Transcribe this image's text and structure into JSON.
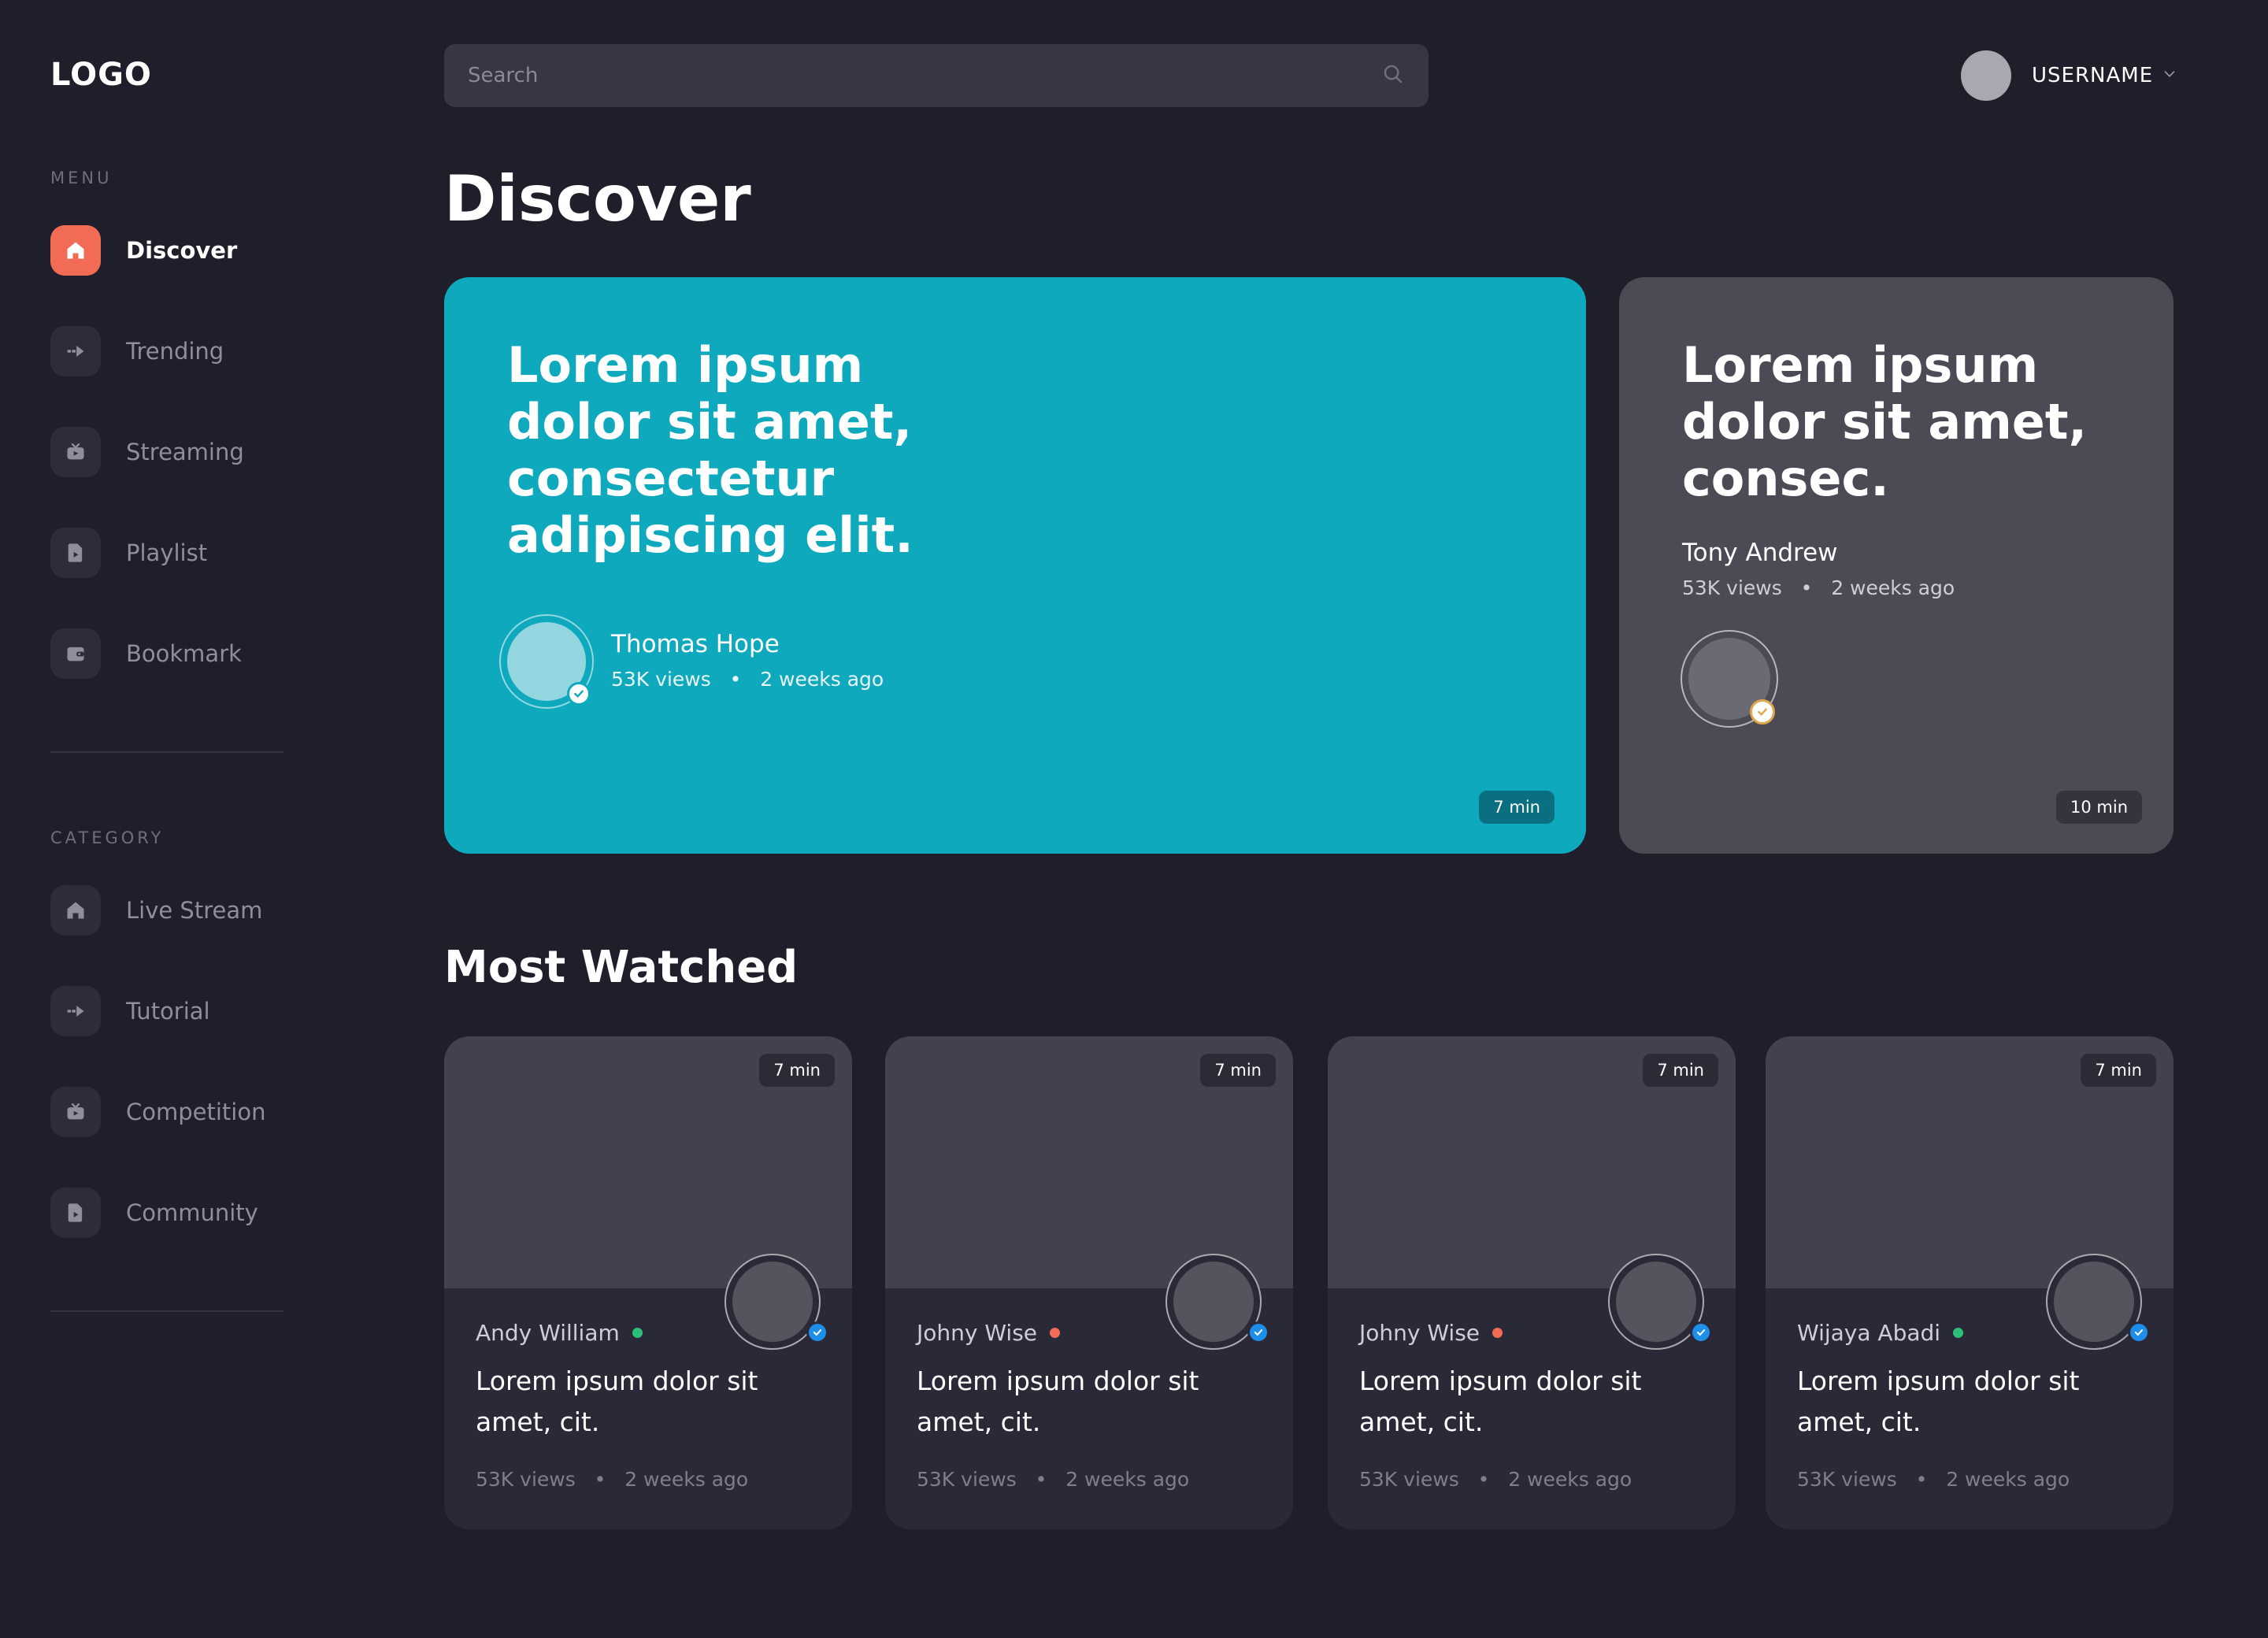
{
  "logo": "LOGO",
  "sidebar": {
    "menu_label": "MENU",
    "menu_items": [
      {
        "label": "Discover",
        "icon": "home-icon",
        "active": true
      },
      {
        "label": "Trending",
        "icon": "arrow-right-icon"
      },
      {
        "label": "Streaming",
        "icon": "tv-icon"
      },
      {
        "label": "Playlist",
        "icon": "document-icon"
      },
      {
        "label": "Bookmark",
        "icon": "wallet-icon"
      }
    ],
    "category_label": "CATEGORY",
    "category_items": [
      {
        "label": "Live Stream",
        "icon": "home-icon"
      },
      {
        "label": "Tutorial",
        "icon": "arrow-right-icon"
      },
      {
        "label": "Competition",
        "icon": "tv-icon"
      },
      {
        "label": "Community",
        "icon": "document-icon"
      }
    ]
  },
  "header": {
    "search_placeholder": "Search",
    "username": "USERNAME"
  },
  "main": {
    "title": "Discover",
    "featured": [
      {
        "title": "Lorem ipsum dolor sit amet, consectetur adipiscing elit.",
        "author": "Thomas Hope",
        "views": "53K views",
        "time": "2 weeks ago",
        "duration": "7 min",
        "color": "#0ea9bd"
      },
      {
        "title": "Lorem ipsum dolor sit amet, consec.",
        "author": "Tony Andrew",
        "views": "53K views",
        "time": "2 weeks ago",
        "duration": "10 min",
        "color": "#4b4a55"
      }
    ],
    "most_watched_title": "Most Watched",
    "most_watched": [
      {
        "author": "Andy William",
        "status_color": "#2bbf7a",
        "title": "Lorem ipsum dolor sit amet, cit.",
        "views": "53K views",
        "time": "2 weeks ago",
        "duration": "7 min"
      },
      {
        "author": "Johny Wise",
        "status_color": "#f26b54",
        "title": "Lorem ipsum dolor sit amet, cit.",
        "views": "53K views",
        "time": "2 weeks ago",
        "duration": "7 min"
      },
      {
        "author": "Johny Wise",
        "status_color": "#f26b54",
        "title": "Lorem ipsum dolor sit amet, cit.",
        "views": "53K views",
        "time": "2 weeks ago",
        "duration": "7 min"
      },
      {
        "author": "Wijaya Abadi",
        "status_color": "#2bbf7a",
        "title": "Lorem ipsum dolor sit amet, cit.",
        "views": "53K views",
        "time": "2 weeks ago",
        "duration": "7 min"
      }
    ]
  },
  "colors": {
    "background": "#1f1e2b",
    "accent": "#f26b54",
    "featured_primary": "#0ea9bd",
    "verified_blue": "#1d8fe8",
    "verified_gold": "#e0a64a"
  }
}
